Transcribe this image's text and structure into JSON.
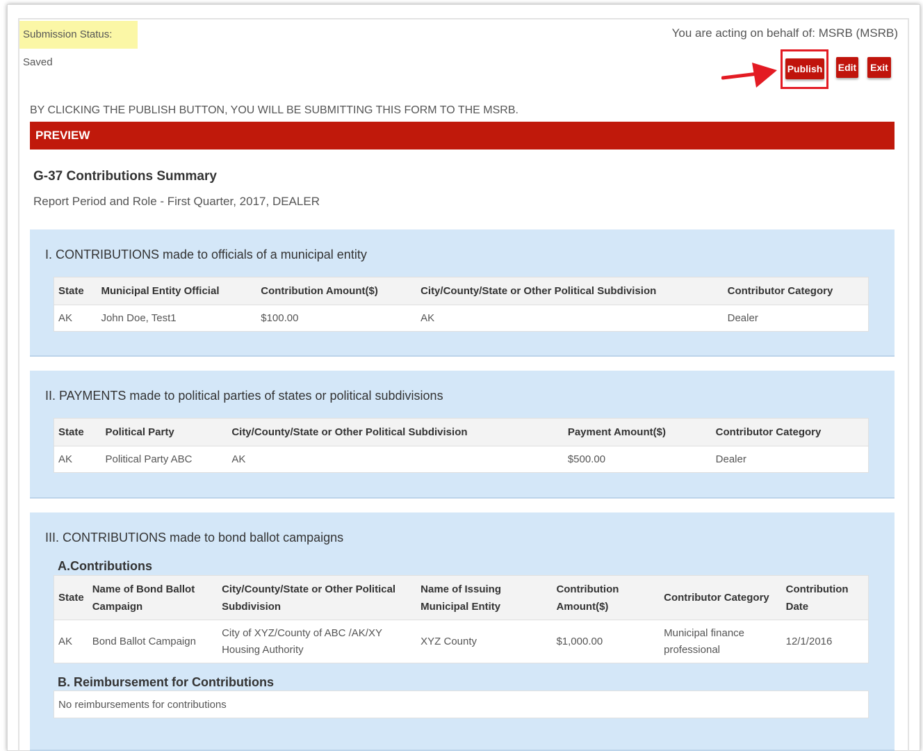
{
  "header": {
    "submission_status": "Submission Status: Saved",
    "acting_on_behalf": "You are acting on behalf of: MSRB (MSRB)"
  },
  "toolbar": {
    "publish_label": "Publish",
    "edit_label": "Edit",
    "exit_label": "Exit"
  },
  "notice": "BY CLICKING THE PUBLISH BUTTON, YOU WILL BE SUBMITTING THIS FORM TO THE MSRB.",
  "preview_label": "PREVIEW",
  "summary": {
    "title": "G-37 Contributions Summary",
    "subtitle": "Report Period and Role - First Quarter, 2017, DEALER"
  },
  "colors": {
    "accent_red": "#c0190b",
    "section_bg": "#d4e7f8",
    "status_bg": "#fbf7a6",
    "annotation_red": "#e31b23"
  },
  "icons": {
    "annotation": "red-arrow-icon"
  },
  "section1": {
    "title": "I. CONTRIBUTIONS made to officials of a municipal entity",
    "headers": [
      "State",
      "Municipal Entity Official",
      "Contribution Amount($)",
      "City/County/State or Other Political Subdivision",
      "Contributor Category"
    ],
    "rows": [
      [
        "AK",
        "John Doe, Test1",
        "$100.00",
        "AK",
        "Dealer"
      ]
    ]
  },
  "section2": {
    "title": "II. PAYMENTS made to political parties of states or political subdivisions",
    "headers": [
      "State",
      "Political Party",
      "City/County/State or Other Political Subdivision",
      "Payment Amount($)",
      "Contributor Category"
    ],
    "rows": [
      [
        "AK",
        "Political Party ABC",
        "AK",
        "$500.00",
        "Dealer"
      ]
    ]
  },
  "section3": {
    "title": "III. CONTRIBUTIONS made to bond ballot campaigns",
    "subsection_a": "A.Contributions",
    "headers": [
      "State",
      "Name of Bond Ballot Campaign",
      "City/County/State or Other Political Subdivision",
      "Name of Issuing Municipal Entity",
      "Contribution Amount($)",
      "Contributor Category",
      "Contribution Date"
    ],
    "rows": [
      [
        "AK",
        "Bond Ballot Campaign",
        "City of XYZ/County of ABC /AK/XY Housing Authority",
        "XYZ County",
        "$1,000.00",
        "Municipal finance professional",
        "12/1/2016"
      ]
    ],
    "subsection_b": "B. Reimbursement for Contributions",
    "reimbursement_text": "No reimbursements for contributions"
  }
}
